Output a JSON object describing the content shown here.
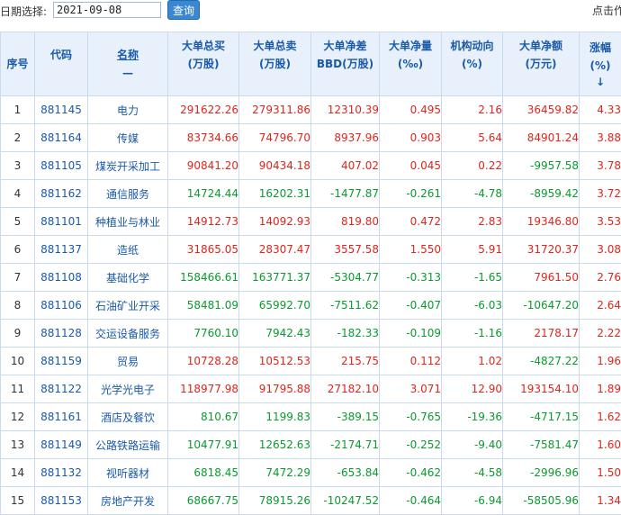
{
  "toolbar": {
    "date_label": "日期选择:",
    "date_value": "2021-09-08",
    "query_label": "查询",
    "right_hint": "点击作"
  },
  "table": {
    "headers": {
      "idx": "序号",
      "code": "代码",
      "name": "名称",
      "name_sub": "—",
      "buy_l1": "大单总买",
      "buy_l2": "(万股)",
      "sell_l1": "大单总卖",
      "sell_l2": "(万股)",
      "bbd_l1": "大单净差",
      "bbd_l2": "BBD(万股)",
      "ratio_l1": "大单净量",
      "ratio_l2": "(‰)",
      "inst_l1": "机构动向",
      "inst_l2": "(%)",
      "amount_l1": "大单净额",
      "amount_l2": "(万元)",
      "chg_l1": "涨幅",
      "chg_l2": "(%)",
      "chg_sort": "↓"
    },
    "rows": [
      {
        "idx": "1",
        "code": "881145",
        "name": "电力",
        "buy": "291622.26",
        "sell": "279311.86",
        "bbd": "12310.39",
        "ratio": "0.495",
        "inst": "2.16",
        "amount": "36459.82",
        "chg": "4.33",
        "dir": "red"
      },
      {
        "idx": "2",
        "code": "881164",
        "name": "传媒",
        "buy": "83734.66",
        "sell": "74796.70",
        "bbd": "8937.96",
        "ratio": "0.903",
        "inst": "5.64",
        "amount": "84901.24",
        "chg": "3.88",
        "dir": "red"
      },
      {
        "idx": "3",
        "code": "881105",
        "name": "煤炭开采加工",
        "buy": "90841.20",
        "sell": "90434.18",
        "bbd": "407.02",
        "ratio": "0.045",
        "inst": "0.22",
        "amount": "-9957.58",
        "chg": "3.78",
        "dir": "red",
        "amount_dir": "green"
      },
      {
        "idx": "4",
        "code": "881162",
        "name": "通信服务",
        "buy": "14724.44",
        "sell": "16202.31",
        "bbd": "-1477.87",
        "ratio": "-0.261",
        "inst": "-4.78",
        "amount": "-8959.42",
        "chg": "3.72",
        "dir": "green"
      },
      {
        "idx": "5",
        "code": "881101",
        "name": "种植业与林业",
        "buy": "14912.73",
        "sell": "14092.93",
        "bbd": "819.80",
        "ratio": "0.472",
        "inst": "2.83",
        "amount": "19346.80",
        "chg": "3.53",
        "dir": "red"
      },
      {
        "idx": "6",
        "code": "881137",
        "name": "造纸",
        "buy": "31865.05",
        "sell": "28307.47",
        "bbd": "3557.58",
        "ratio": "1.550",
        "inst": "5.91",
        "amount": "31720.37",
        "chg": "3.08",
        "dir": "red"
      },
      {
        "idx": "7",
        "code": "881108",
        "name": "基础化学",
        "buy": "158466.61",
        "sell": "163771.37",
        "bbd": "-5304.77",
        "ratio": "-0.313",
        "inst": "-1.65",
        "amount": "7961.50",
        "chg": "2.76",
        "dir": "green",
        "amount_dir": "red"
      },
      {
        "idx": "8",
        "code": "881106",
        "name": "石油矿业开采",
        "buy": "58481.09",
        "sell": "65992.70",
        "bbd": "-7511.62",
        "ratio": "-0.407",
        "inst": "-6.03",
        "amount": "-10647.20",
        "chg": "2.64",
        "dir": "green"
      },
      {
        "idx": "9",
        "code": "881128",
        "name": "交运设备服务",
        "buy": "7760.10",
        "sell": "7942.43",
        "bbd": "-182.33",
        "ratio": "-0.109",
        "inst": "-1.16",
        "amount": "2178.17",
        "chg": "2.22",
        "dir": "green",
        "amount_dir": "red"
      },
      {
        "idx": "10",
        "code": "881159",
        "name": "贸易",
        "buy": "10728.28",
        "sell": "10512.53",
        "bbd": "215.75",
        "ratio": "0.112",
        "inst": "1.02",
        "amount": "-4827.22",
        "chg": "1.96",
        "dir": "red",
        "amount_dir": "green"
      },
      {
        "idx": "11",
        "code": "881122",
        "name": "光学光电子",
        "buy": "118977.98",
        "sell": "91795.88",
        "bbd": "27182.10",
        "ratio": "3.071",
        "inst": "12.90",
        "amount": "193154.10",
        "chg": "1.89",
        "dir": "red"
      },
      {
        "idx": "12",
        "code": "881161",
        "name": "酒店及餐饮",
        "buy": "810.67",
        "sell": "1199.83",
        "bbd": "-389.15",
        "ratio": "-0.765",
        "inst": "-19.36",
        "amount": "-4717.15",
        "chg": "1.62",
        "dir": "green"
      },
      {
        "idx": "13",
        "code": "881149",
        "name": "公路铁路运输",
        "buy": "10477.91",
        "sell": "12652.63",
        "bbd": "-2174.71",
        "ratio": "-0.252",
        "inst": "-9.40",
        "amount": "-7581.47",
        "chg": "1.60",
        "dir": "green"
      },
      {
        "idx": "14",
        "code": "881132",
        "name": "视听器材",
        "buy": "6818.45",
        "sell": "7472.29",
        "bbd": "-653.84",
        "ratio": "-0.462",
        "inst": "-4.58",
        "amount": "-2996.96",
        "chg": "1.50",
        "dir": "green"
      },
      {
        "idx": "15",
        "code": "881153",
        "name": "房地产开发",
        "buy": "68667.75",
        "sell": "78915.26",
        "bbd": "-10247.52",
        "ratio": "-0.464",
        "inst": "-6.94",
        "amount": "-58505.96",
        "chg": "1.34",
        "dir": "green"
      }
    ]
  },
  "colors": {
    "up": "#e0251c",
    "down": "#0a9a2e",
    "header_bg": "#e8f1fb",
    "header_text": "#1a5aa8",
    "link": "#1a5aa8",
    "button_bg": "#3a86d1"
  }
}
